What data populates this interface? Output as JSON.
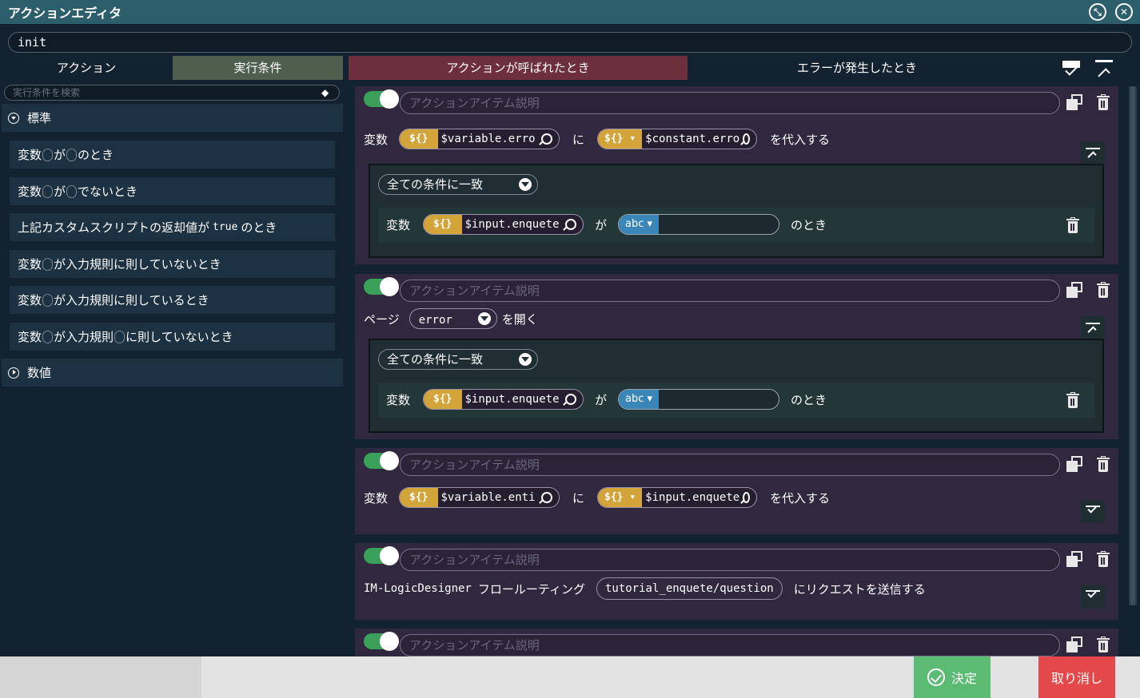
{
  "title": "アクションエディタ",
  "action_name": "init",
  "left_tabs": [
    "アクション",
    "実行条件"
  ],
  "condition_search_placeholder": "実行条件を検索",
  "categories": {
    "standard": "標準",
    "numeric": "数値"
  },
  "condition_items": [
    {
      "a": "変数",
      "b": "が",
      "c": "のとき"
    },
    {
      "a": "変数",
      "b": "が",
      "c": "でないとき"
    },
    {
      "a": "上記カスタムスクリプトの返却値が",
      "code": "true",
      "c": "のとき"
    },
    {
      "a": "変数",
      "b": "が入力規則に則していないとき"
    },
    {
      "a": "変数",
      "b": "が入力規則に則しているとき"
    },
    {
      "a": "変数",
      "b": "が入力規則",
      "c": "に則していないとき"
    }
  ],
  "right_tabs": [
    "アクションが呼ばれたとき",
    "エラーが発生したとき"
  ],
  "desc_placeholder": "アクションアイテム説明",
  "actions": [
    {
      "label": "変数",
      "tag": "${}",
      "var": "$variable.erro",
      "mid": "に",
      "tag2": "${}",
      "var2": "$constant.erro",
      "end": "を代入する",
      "cond": {
        "mode": "全ての条件に一致",
        "label": "変数",
        "tag": "${}",
        "var": "$input.enquete",
        "mid": "が",
        "type": "abc",
        "end": "のとき"
      }
    },
    {
      "label": "ページ",
      "page": "error",
      "end": "を開く",
      "cond": {
        "mode": "全ての条件に一致",
        "label": "変数",
        "tag": "${}",
        "var": "$input.enquete",
        "mid": "が",
        "type": "abc",
        "end": "のとき"
      }
    },
    {
      "label": "変数",
      "tag": "${}",
      "var": "$variable.enti",
      "mid": "に",
      "tag2": "${}",
      "var2": "$input.enquete",
      "end": "を代入する"
    },
    {
      "label": "IM-LogicDesigner",
      "label2": "フロールーティング",
      "route": "tutorial_enquete/question",
      "end": "にリクエストを送信する"
    },
    {}
  ],
  "footer": {
    "ok": "決定",
    "cancel": "取り消し"
  },
  "colors": {
    "titlebar": "#2d5e6c",
    "active_left_tab": "#4e5f4e",
    "active_right_tab": "#6e2f3d",
    "card": "#30283f",
    "variable_tag": "#d2a43a",
    "type_tag": "#3a86b8",
    "ok": "#5bbb72",
    "cancel": "#e4484b"
  }
}
